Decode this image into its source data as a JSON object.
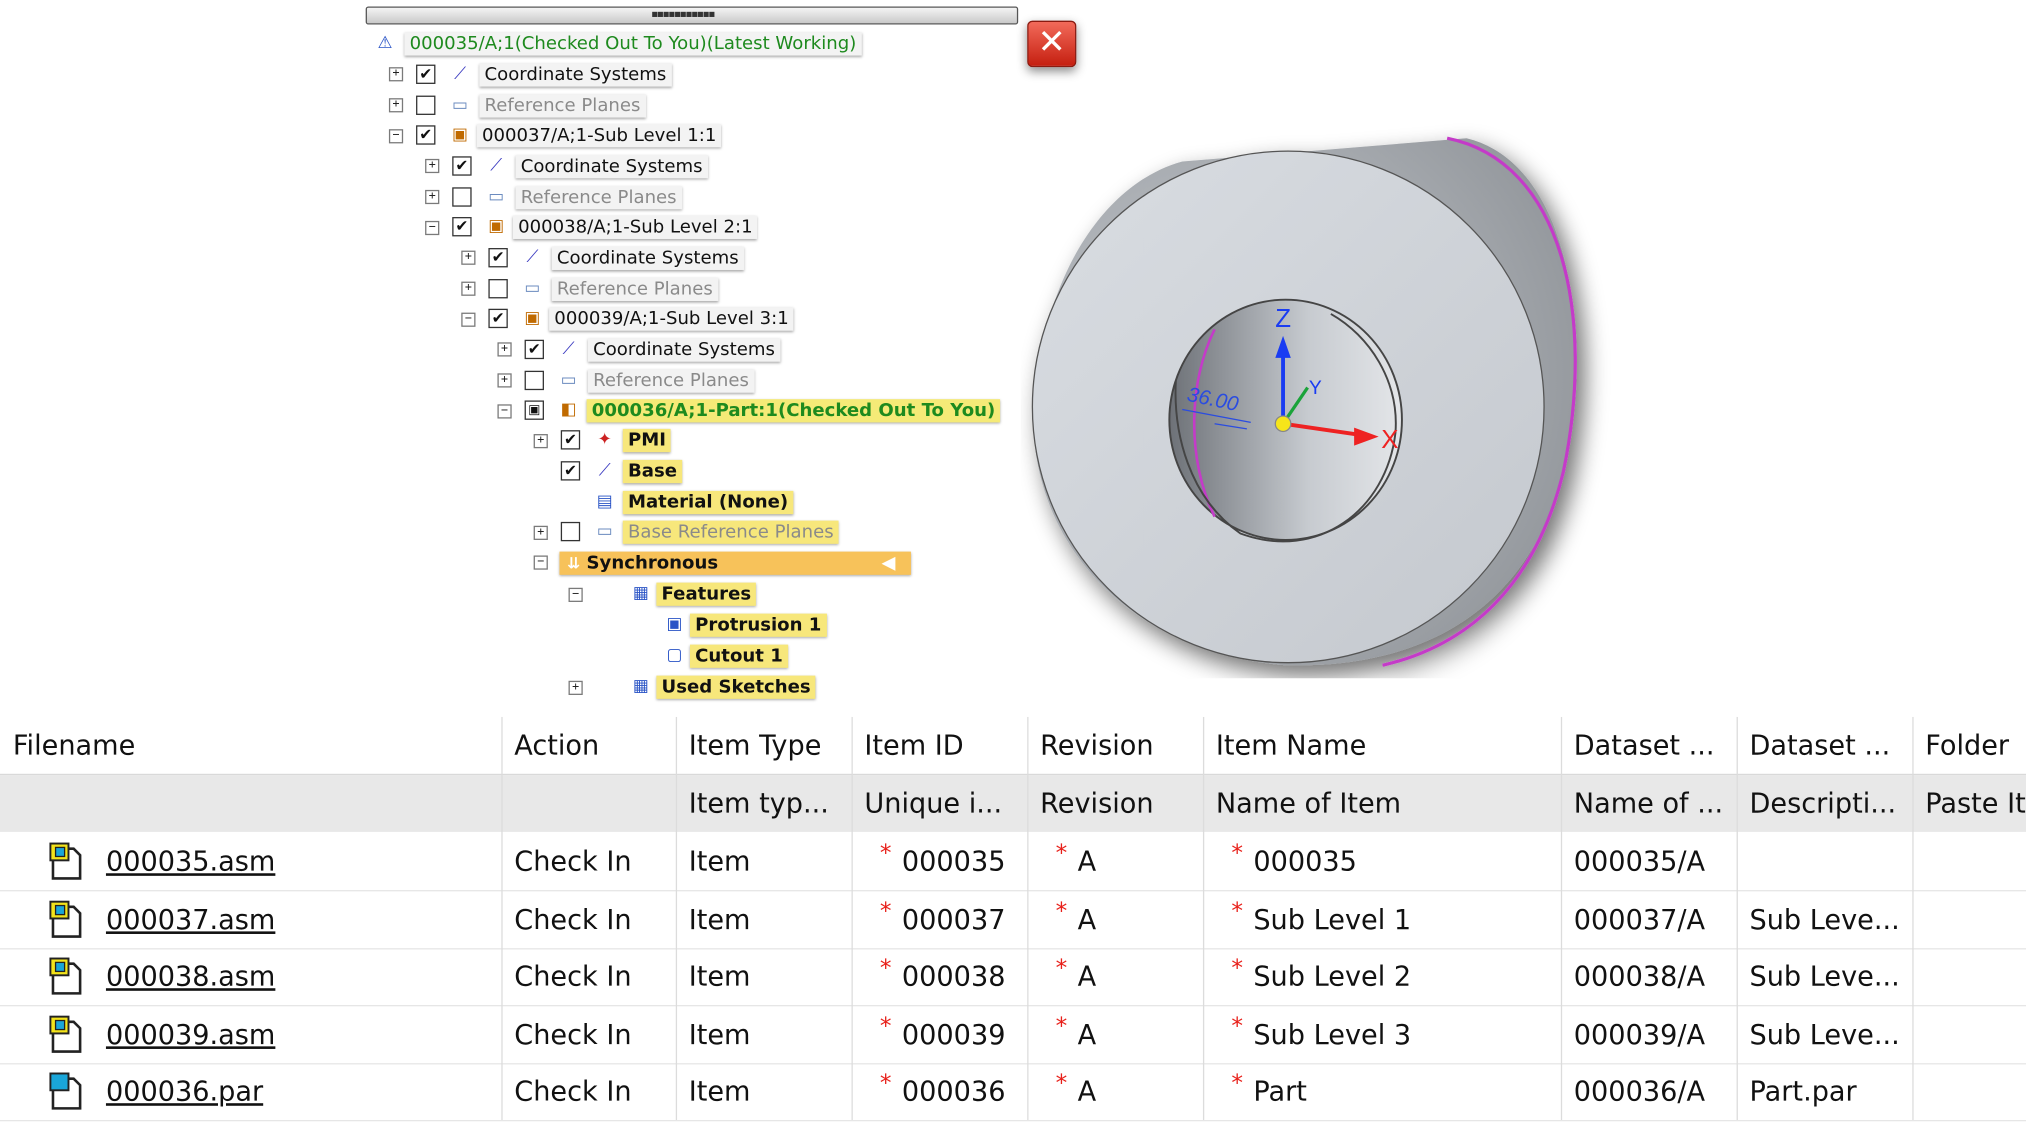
{
  "tree": {
    "items": [
      {
        "label": "000035/A;1(Checked Out To You)(Latest Working)",
        "icon": "assembly-root-icon"
      },
      {
        "label": "Coordinate Systems",
        "icon": "coordinate-system-icon"
      },
      {
        "label": "Reference Planes",
        "icon": "reference-planes-icon"
      },
      {
        "label": "000037/A;1-Sub Level 1:1",
        "icon": "subassembly-icon"
      },
      {
        "label": "Coordinate Systems",
        "icon": "coordinate-system-icon"
      },
      {
        "label": "Reference Planes",
        "icon": "reference-planes-icon"
      },
      {
        "label": "000038/A;1-Sub Level 2:1",
        "icon": "subassembly-icon"
      },
      {
        "label": "Coordinate Systems",
        "icon": "coordinate-system-icon"
      },
      {
        "label": "Reference Planes",
        "icon": "reference-planes-icon"
      },
      {
        "label": "000039/A;1-Sub Level 3:1",
        "icon": "subassembly-icon"
      },
      {
        "label": "Coordinate Systems",
        "icon": "coordinate-system-icon"
      },
      {
        "label": "Reference Planes",
        "icon": "reference-planes-icon"
      },
      {
        "label": "000036/A;1-Part:1(Checked Out To You)",
        "icon": "part-icon"
      },
      {
        "label": "PMI",
        "icon": "pmi-icon"
      },
      {
        "label": "Base",
        "icon": "coordinate-system-icon"
      },
      {
        "label": "Material (None)",
        "icon": "material-icon"
      },
      {
        "label": "Base Reference Planes",
        "icon": "reference-planes-icon"
      },
      {
        "label": "Synchronous",
        "icon": "synchronous-icon"
      },
      {
        "label": "Features",
        "icon": "features-icon"
      },
      {
        "label": "Protrusion 1",
        "icon": "protrusion-icon"
      },
      {
        "label": "Cutout 1",
        "icon": "cutout-icon"
      },
      {
        "label": "Used Sketches",
        "icon": "sketches-icon"
      }
    ]
  },
  "close_icon": "close-icon",
  "view": {
    "axis_x": "X",
    "axis_y": "Y",
    "axis_z": "Z",
    "dimension": "36.00"
  },
  "table": {
    "headers": [
      "Filename",
      "Action",
      "Item Type",
      "Item ID",
      "Revision",
      "Item Name",
      "Dataset ...",
      "Dataset ...",
      "Folder"
    ],
    "subheaders": [
      "",
      "",
      "Item typ...",
      "Unique i...",
      "Revision",
      "Name of Item",
      "Name of ...",
      "Descripti...",
      "Paste Ite"
    ],
    "rows": [
      {
        "filename": "000035.asm",
        "action": "Check In",
        "item_type": "Item",
        "item_id": "000035",
        "revision": "A",
        "item_name": "000035",
        "dataset_name": "000035/A",
        "dataset_desc": "",
        "folder": ""
      },
      {
        "filename": "000037.asm",
        "action": "Check In",
        "item_type": "Item",
        "item_id": "000037",
        "revision": "A",
        "item_name": "Sub Level 1",
        "dataset_name": "000037/A",
        "dataset_desc": "Sub Leve...",
        "folder": ""
      },
      {
        "filename": "000038.asm",
        "action": "Check In",
        "item_type": "Item",
        "item_id": "000038",
        "revision": "A",
        "item_name": "Sub Level 2",
        "dataset_name": "000038/A",
        "dataset_desc": "Sub Leve...",
        "folder": ""
      },
      {
        "filename": "000039.asm",
        "action": "Check In",
        "item_type": "Item",
        "item_id": "000039",
        "revision": "A",
        "item_name": "Sub Level 3",
        "dataset_name": "000039/A",
        "dataset_desc": "Sub Leve...",
        "folder": ""
      },
      {
        "filename": "000036.par",
        "action": "Check In",
        "item_type": "Item",
        "item_id": "000036",
        "revision": "A",
        "item_name": "Part",
        "dataset_name": "000036/A",
        "dataset_desc": "Part.par",
        "folder": ""
      }
    ],
    "required_marker": "*"
  },
  "colors": {
    "required": "#e8201a",
    "checked_out_text": "#1e8a1e",
    "highlight_yellow": "#f7e77b",
    "highlight_orange": "#f7c25a"
  }
}
